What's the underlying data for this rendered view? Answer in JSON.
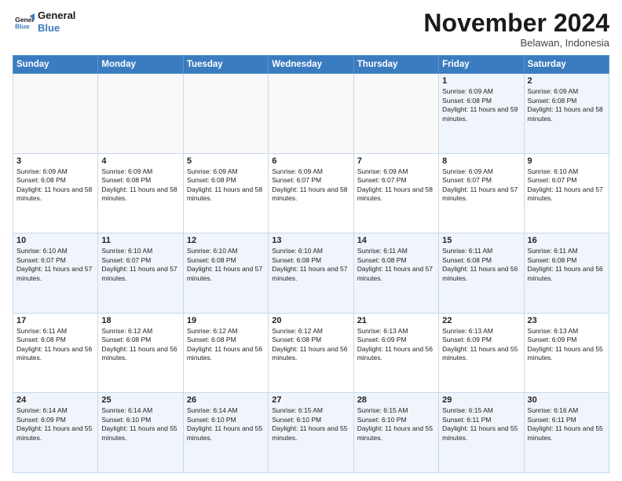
{
  "header": {
    "logo_line1": "General",
    "logo_line2": "Blue",
    "month_title": "November 2024",
    "location": "Belawan, Indonesia"
  },
  "weekdays": [
    "Sunday",
    "Monday",
    "Tuesday",
    "Wednesday",
    "Thursday",
    "Friday",
    "Saturday"
  ],
  "weeks": [
    [
      {
        "day": "",
        "info": ""
      },
      {
        "day": "",
        "info": ""
      },
      {
        "day": "",
        "info": ""
      },
      {
        "day": "",
        "info": ""
      },
      {
        "day": "",
        "info": ""
      },
      {
        "day": "1",
        "info": "Sunrise: 6:09 AM\nSunset: 6:08 PM\nDaylight: 11 hours and 59 minutes."
      },
      {
        "day": "2",
        "info": "Sunrise: 6:09 AM\nSunset: 6:08 PM\nDaylight: 11 hours and 58 minutes."
      }
    ],
    [
      {
        "day": "3",
        "info": "Sunrise: 6:09 AM\nSunset: 6:08 PM\nDaylight: 11 hours and 58 minutes."
      },
      {
        "day": "4",
        "info": "Sunrise: 6:09 AM\nSunset: 6:08 PM\nDaylight: 11 hours and 58 minutes."
      },
      {
        "day": "5",
        "info": "Sunrise: 6:09 AM\nSunset: 6:08 PM\nDaylight: 11 hours and 58 minutes."
      },
      {
        "day": "6",
        "info": "Sunrise: 6:09 AM\nSunset: 6:07 PM\nDaylight: 11 hours and 58 minutes."
      },
      {
        "day": "7",
        "info": "Sunrise: 6:09 AM\nSunset: 6:07 PM\nDaylight: 11 hours and 58 minutes."
      },
      {
        "day": "8",
        "info": "Sunrise: 6:09 AM\nSunset: 6:07 PM\nDaylight: 11 hours and 57 minutes."
      },
      {
        "day": "9",
        "info": "Sunrise: 6:10 AM\nSunset: 6:07 PM\nDaylight: 11 hours and 57 minutes."
      }
    ],
    [
      {
        "day": "10",
        "info": "Sunrise: 6:10 AM\nSunset: 6:07 PM\nDaylight: 11 hours and 57 minutes."
      },
      {
        "day": "11",
        "info": "Sunrise: 6:10 AM\nSunset: 6:07 PM\nDaylight: 11 hours and 57 minutes."
      },
      {
        "day": "12",
        "info": "Sunrise: 6:10 AM\nSunset: 6:08 PM\nDaylight: 11 hours and 57 minutes."
      },
      {
        "day": "13",
        "info": "Sunrise: 6:10 AM\nSunset: 6:08 PM\nDaylight: 11 hours and 57 minutes."
      },
      {
        "day": "14",
        "info": "Sunrise: 6:11 AM\nSunset: 6:08 PM\nDaylight: 11 hours and 57 minutes."
      },
      {
        "day": "15",
        "info": "Sunrise: 6:11 AM\nSunset: 6:08 PM\nDaylight: 11 hours and 56 minutes."
      },
      {
        "day": "16",
        "info": "Sunrise: 6:11 AM\nSunset: 6:08 PM\nDaylight: 11 hours and 56 minutes."
      }
    ],
    [
      {
        "day": "17",
        "info": "Sunrise: 6:11 AM\nSunset: 6:08 PM\nDaylight: 11 hours and 56 minutes."
      },
      {
        "day": "18",
        "info": "Sunrise: 6:12 AM\nSunset: 6:08 PM\nDaylight: 11 hours and 56 minutes."
      },
      {
        "day": "19",
        "info": "Sunrise: 6:12 AM\nSunset: 6:08 PM\nDaylight: 11 hours and 56 minutes."
      },
      {
        "day": "20",
        "info": "Sunrise: 6:12 AM\nSunset: 6:08 PM\nDaylight: 11 hours and 56 minutes."
      },
      {
        "day": "21",
        "info": "Sunrise: 6:13 AM\nSunset: 6:09 PM\nDaylight: 11 hours and 56 minutes."
      },
      {
        "day": "22",
        "info": "Sunrise: 6:13 AM\nSunset: 6:09 PM\nDaylight: 11 hours and 55 minutes."
      },
      {
        "day": "23",
        "info": "Sunrise: 6:13 AM\nSunset: 6:09 PM\nDaylight: 11 hours and 55 minutes."
      }
    ],
    [
      {
        "day": "24",
        "info": "Sunrise: 6:14 AM\nSunset: 6:09 PM\nDaylight: 11 hours and 55 minutes."
      },
      {
        "day": "25",
        "info": "Sunrise: 6:14 AM\nSunset: 6:10 PM\nDaylight: 11 hours and 55 minutes."
      },
      {
        "day": "26",
        "info": "Sunrise: 6:14 AM\nSunset: 6:10 PM\nDaylight: 11 hours and 55 minutes."
      },
      {
        "day": "27",
        "info": "Sunrise: 6:15 AM\nSunset: 6:10 PM\nDaylight: 11 hours and 55 minutes."
      },
      {
        "day": "28",
        "info": "Sunrise: 6:15 AM\nSunset: 6:10 PM\nDaylight: 11 hours and 55 minutes."
      },
      {
        "day": "29",
        "info": "Sunrise: 6:15 AM\nSunset: 6:11 PM\nDaylight: 11 hours and 55 minutes."
      },
      {
        "day": "30",
        "info": "Sunrise: 6:16 AM\nSunset: 6:11 PM\nDaylight: 11 hours and 55 minutes."
      }
    ]
  ]
}
